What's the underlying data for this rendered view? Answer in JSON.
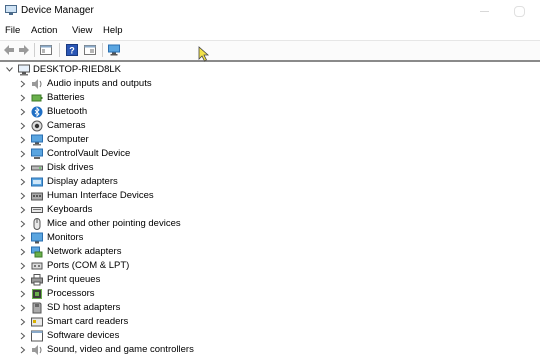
{
  "window": {
    "title": "Device Manager"
  },
  "menu": {
    "file": "File",
    "action": "Action",
    "view": "View",
    "help": "Help"
  },
  "tree": {
    "root": "DESKTOP-RIED8LK",
    "items": [
      {
        "label": "Audio inputs and outputs",
        "icon": "speaker-icon"
      },
      {
        "label": "Batteries",
        "icon": "battery-icon"
      },
      {
        "label": "Bluetooth",
        "icon": "bluetooth-icon"
      },
      {
        "label": "Cameras",
        "icon": "camera-icon"
      },
      {
        "label": "Computer",
        "icon": "computer-icon"
      },
      {
        "label": "ControlVault Device",
        "icon": "device-icon"
      },
      {
        "label": "Disk drives",
        "icon": "disk-icon"
      },
      {
        "label": "Display adapters",
        "icon": "display-adapter-icon"
      },
      {
        "label": "Human Interface Devices",
        "icon": "hid-icon"
      },
      {
        "label": "Keyboards",
        "icon": "keyboard-icon"
      },
      {
        "label": "Mice and other pointing devices",
        "icon": "mouse-icon"
      },
      {
        "label": "Monitors",
        "icon": "monitor-icon"
      },
      {
        "label": "Network adapters",
        "icon": "network-icon"
      },
      {
        "label": "Ports (COM & LPT)",
        "icon": "port-icon"
      },
      {
        "label": "Print queues",
        "icon": "printer-icon"
      },
      {
        "label": "Processors",
        "icon": "processor-icon"
      },
      {
        "label": "SD host adapters",
        "icon": "sd-icon"
      },
      {
        "label": "Smart card readers",
        "icon": "smartcard-icon"
      },
      {
        "label": "Software devices",
        "icon": "software-icon"
      },
      {
        "label": "Sound, video and game controllers",
        "icon": "sound-icon"
      }
    ]
  },
  "colors": {
    "accent": "#1f6fc5",
    "toolbar_border": "#8a8a8a"
  }
}
